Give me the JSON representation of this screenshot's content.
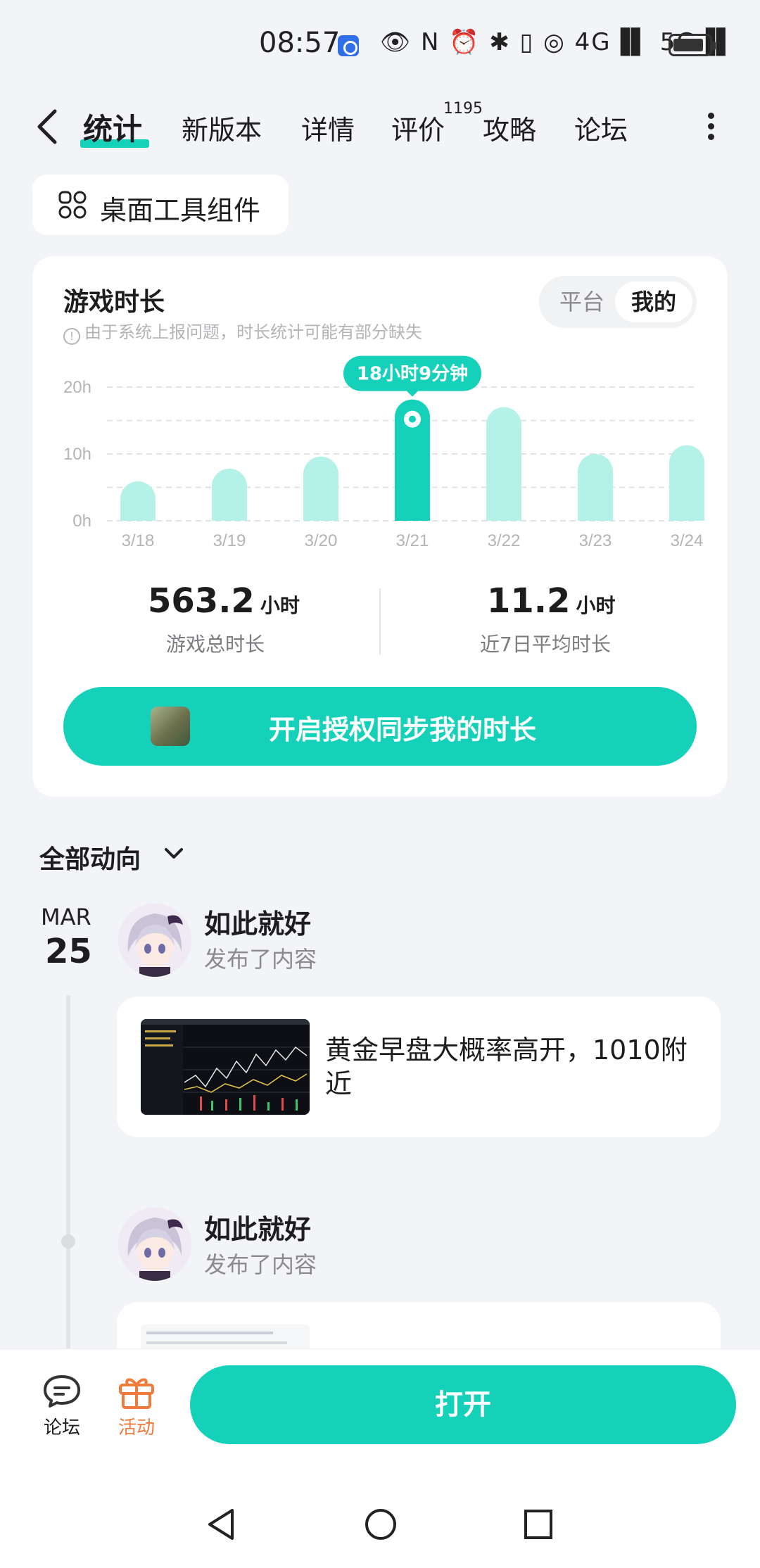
{
  "status_bar": {
    "time": "08:57",
    "icons": [
      "eye-icon",
      "nfc-icon",
      "alarm-icon",
      "bluetooth-icon",
      "vibrate-icon",
      "hotspot-icon",
      "signal-4g-icon",
      "signal-5g-icon",
      "battery-icon"
    ],
    "icons_text": "👁 N ⏰ ✱ ▯ ◎ 4G▐▌ 5G▐▌"
  },
  "nav": {
    "tabs": [
      {
        "label": "统计"
      },
      {
        "label": "新版本"
      },
      {
        "label": "详情"
      },
      {
        "label": "评价"
      },
      {
        "label": "攻略"
      },
      {
        "label": "论坛"
      }
    ],
    "rating_count": "1195"
  },
  "widget": {
    "label": "桌面工具组件"
  },
  "playtime": {
    "title": "游戏时长",
    "subtitle": "由于系统上报问题，时长统计可能有部分缺失",
    "toggle": {
      "platform": "平台",
      "mine": "我的"
    },
    "total_value": "563.2",
    "total_unit": "小时",
    "total_label": "游戏总时长",
    "avg_value": "11.2",
    "avg_unit": "小时",
    "avg_label": "近7日平均时长",
    "sync_button": "开启授权同步我的时长"
  },
  "chart_data": {
    "type": "bar",
    "categories": [
      "3/18",
      "3/19",
      "3/20",
      "3/21",
      "3/22",
      "3/23",
      "3/24"
    ],
    "values": [
      5.9,
      7.8,
      9.6,
      18.15,
      17.0,
      10.0,
      11.3
    ],
    "y_ticks": [
      "0h",
      "10h",
      "20h"
    ],
    "ylim": [
      0,
      20
    ],
    "highlight_index": 3,
    "highlight_label": "18小时9分钟",
    "colors": {
      "bar": "#b3f1e9",
      "highlight": "#15d1b9"
    },
    "grid": true
  },
  "feed": {
    "filter_label": "全部动向",
    "date_month": "MAR",
    "date_day": "25",
    "posts": [
      {
        "user": "如此就好",
        "action": "发布了内容",
        "text": "黄金早盘大概率高开，1010附近"
      },
      {
        "user": "如此就好",
        "action": "发布了内容"
      }
    ]
  },
  "bottom": {
    "forum_label": "论坛",
    "activity_label": "活动",
    "open_label": "打开"
  },
  "colors": {
    "accent": "#15d1b9",
    "activity": "#f07b3a"
  }
}
